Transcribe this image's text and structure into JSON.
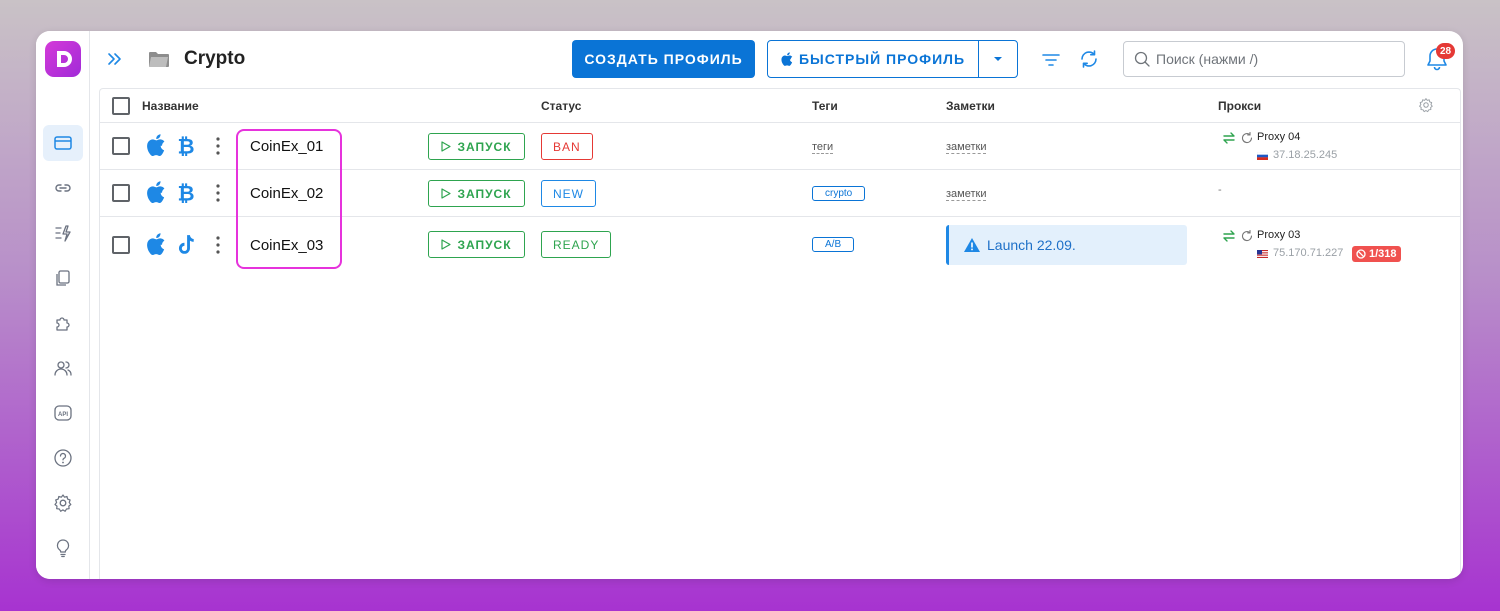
{
  "header": {
    "title": "Crypto",
    "create_label": "СОЗДАТЬ ПРОФИЛЬ",
    "quick_label": "БЫСТРЫЙ ПРОФИЛЬ",
    "search_placeholder": "Поиск (нажми /)",
    "notification_count": "28"
  },
  "sidebar": {
    "items": [
      {
        "name": "browser-profiles",
        "active": true
      },
      {
        "name": "links"
      },
      {
        "name": "automation"
      },
      {
        "name": "bookmarks"
      },
      {
        "name": "extensions"
      },
      {
        "name": "team"
      },
      {
        "name": "api"
      },
      {
        "name": "help"
      },
      {
        "name": "settings"
      },
      {
        "name": "tips"
      }
    ]
  },
  "table": {
    "columns": {
      "name": "Название",
      "status": "Статус",
      "tags": "Теги",
      "notes": "Заметки",
      "proxy": "Прокси"
    },
    "rows": [
      {
        "name": "CoinEx_01",
        "os_icon": "apple-icon",
        "app_icon": "bitcoin-icon",
        "run_label": "ЗАПУСК",
        "status": "BAN",
        "status_color": "#e53935",
        "tag": "теги",
        "tag_is_chip": false,
        "note": "заметки",
        "note_is_alert": false,
        "proxy_name": "Proxy 04",
        "proxy_ip": "37.18.25.245",
        "proxy_flag": "ru"
      },
      {
        "name": "CoinEx_02",
        "os_icon": "apple-icon",
        "app_icon": "bitcoin-icon",
        "run_label": "ЗАПУСК",
        "status": "NEW",
        "status_color": "#1e88e5",
        "tag": "crypto",
        "tag_is_chip": true,
        "note": "заметки",
        "note_is_alert": false,
        "proxy_name": "-"
      },
      {
        "name": "CoinEx_03",
        "os_icon": "apple-icon",
        "app_icon": "tiktok-icon",
        "run_label": "ЗАПУСК",
        "status": "READY",
        "status_color": "#2ea44f",
        "tag": "A/B",
        "tag_is_chip": true,
        "note": "Launch 22.09.",
        "note_is_alert": true,
        "proxy_name": "Proxy 03",
        "proxy_ip": "75.170.71.227",
        "proxy_flag": "us",
        "proxy_badge": "1/318"
      }
    ]
  },
  "colors": {
    "accent": "#0a74d6",
    "highlight": "#e633dc",
    "run": "#2ea44f"
  }
}
